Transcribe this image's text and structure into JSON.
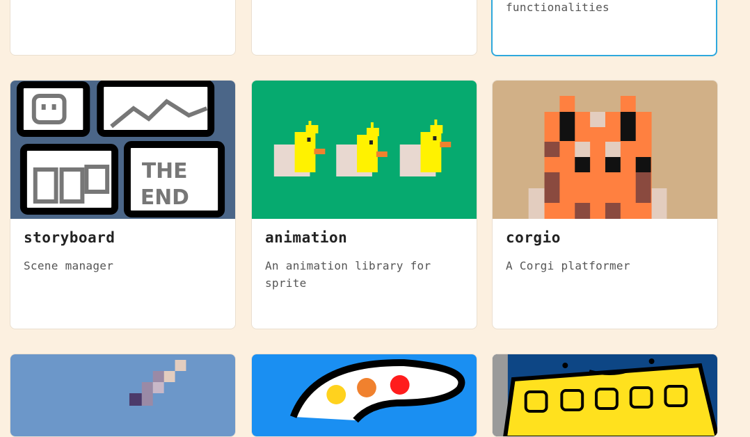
{
  "top_row": [
    {
      "name": "",
      "description": ""
    },
    {
      "name": "",
      "description": ""
    },
    {
      "name": "",
      "description": "functionalities",
      "selected": true
    }
  ],
  "cards": [
    {
      "name": "storyboard",
      "description": "Scene manager",
      "thumbnail": "storyboard-comic-panels",
      "thumb_color": "#4b6688"
    },
    {
      "name": "animation",
      "description": "An animation library for sprite",
      "thumbnail": "pixel-ducks",
      "thumb_color": "#06aa6f"
    },
    {
      "name": "corgio",
      "description": "A Corgi platformer",
      "thumbnail": "pixel-corgi-face",
      "thumb_color": "#d1b087"
    }
  ],
  "bottom_row": [
    {
      "thumbnail": "pixel-sword",
      "thumb_color": "#6c97c9"
    },
    {
      "thumbnail": "paint-palette",
      "thumb_color": "#1a8ff2"
    },
    {
      "thumbnail": "keyboard-robot",
      "thumb_color": "#0d4685"
    }
  ],
  "colors": {
    "page_background": "#fcf0e0",
    "card_background": "#ffffff",
    "selected_border": "#2ea8dd"
  }
}
